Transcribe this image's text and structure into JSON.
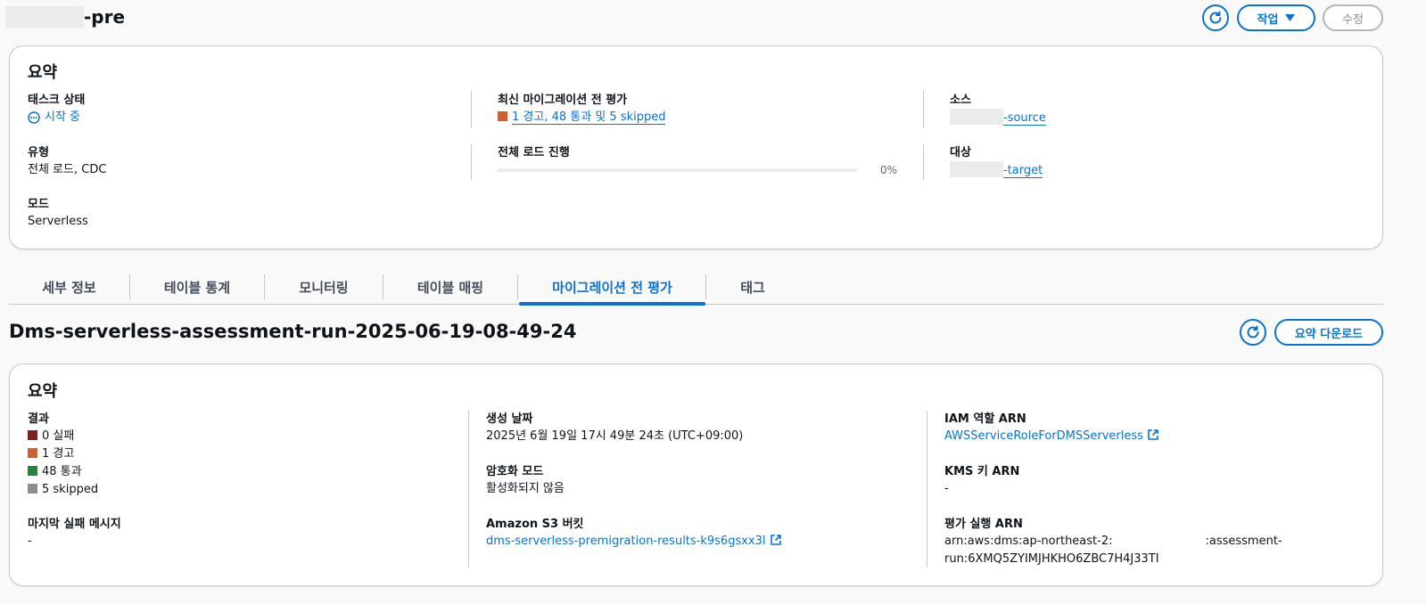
{
  "header": {
    "title": "-pre",
    "actions_label": "작업",
    "edit_label": "수정"
  },
  "task_summary": {
    "title": "요약",
    "status_label": "태스크 상태",
    "status_value": "시작 중",
    "type_label": "유형",
    "type_value": "전체 로드, CDC",
    "mode_label": "모드",
    "mode_value": "Serverless",
    "premigration_label": "최신 마이그레이션 전 평가",
    "premigration_value": "1 경고, 48 통과 및 5 skipped",
    "fullload_label": "전체 로드 진행",
    "fullload_percent_text": "0%",
    "fullload_progress": 0,
    "source_label": "소스",
    "source_value": "-source",
    "target_label": "대상",
    "target_value": "-target"
  },
  "tabs": [
    {
      "label": "세부 정보",
      "active": false
    },
    {
      "label": "테이블 통계",
      "active": false
    },
    {
      "label": "모니터링",
      "active": false
    },
    {
      "label": "테이블 매핑",
      "active": false
    },
    {
      "label": "마이그레이션 전 평가",
      "active": true
    },
    {
      "label": "태그",
      "active": false
    }
  ],
  "assessment": {
    "run_title": "Dms-serverless-assessment-run-2025-06-19-08-49-24",
    "download_label": "요약 다운로드",
    "summary_title": "요약",
    "result_label": "결과",
    "results": [
      {
        "text": "0 실패",
        "color": "#7d1f1a"
      },
      {
        "text": "1 경고",
        "color": "#d15f2f"
      },
      {
        "text": "48 통과",
        "color": "#1d8a3a"
      },
      {
        "text": "5 skipped",
        "color": "#8c8c94"
      }
    ],
    "last_failure_label": "마지막 실패 메시지",
    "last_failure_value": "-",
    "created_label": "생성 날짜",
    "created_value": "2025년 6월 19일 17시 49분 24초 (UTC+09:00)",
    "encryption_label": "암호화 모드",
    "encryption_value": "활성화되지 않음",
    "s3_label": "Amazon S3 버킷",
    "s3_value": "dms-serverless-premigration-results-k9s6gsxx3l",
    "iam_label": "IAM 역할 ARN",
    "iam_value": "AWSServiceRoleForDMSServerless",
    "kms_label": "KMS 키 ARN",
    "kms_value": "-",
    "run_arn_label": "평가 실행 ARN",
    "run_arn_prefix": "arn:aws:dms:ap-northeast-2:",
    "run_arn_suffix_1": ":assessment-",
    "run_arn_suffix_2": "run:6XMQ5ZYIMJHKHO6ZBC7H4J33TI"
  },
  "colors": {
    "accent": "#0972d3",
    "warning": "#d15f2f",
    "border": "#c6c6cd"
  },
  "icons": {
    "refresh": "refresh-icon",
    "dropdown": "caret-down-icon",
    "status": "in-progress-icon",
    "external": "external-link-icon"
  }
}
